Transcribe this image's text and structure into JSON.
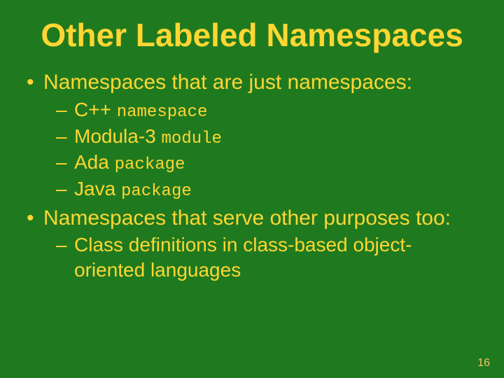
{
  "title": "Other Labeled Namespaces",
  "bullets": {
    "b1": "Namespaces that are just namespaces:",
    "b2": "Namespaces that serve other purposes too:"
  },
  "sub1": {
    "i1_lang": "C++",
    "i1_kw": "namespace",
    "i2_lang": "Modula-3",
    "i2_kw": "module",
    "i3_lang": "Ada",
    "i3_kw": "package",
    "i4_lang": "Java",
    "i4_kw": "package"
  },
  "sub2": {
    "i1": "Class definitions in class-based object-oriented languages"
  },
  "page_number": "16"
}
